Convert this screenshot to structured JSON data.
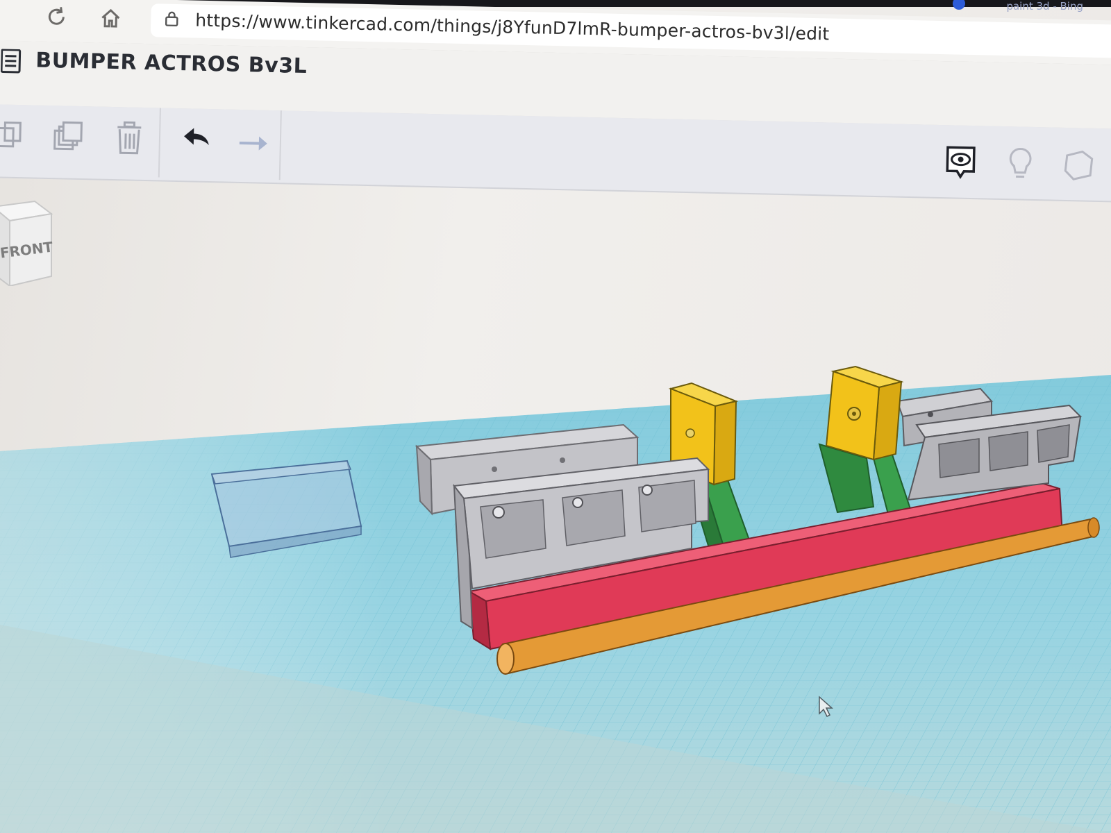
{
  "browser": {
    "url": "https://www.tinkercad.com/things/j8YfunD7lmR-bumper-actros-bv3l/edit",
    "tab_hint": "paint 3d - Bing"
  },
  "app": {
    "title": "BUMPER ACTROS Bv3L"
  },
  "toolbar": {
    "left_tools": [
      "copy-icon",
      "duplicate-icon",
      "trash-icon",
      "undo-icon",
      "redo-icon"
    ],
    "right_tools": [
      "show-all-icon",
      "light-bulb-icon",
      "group-icon"
    ]
  },
  "viewcube": {
    "face_label": "FRONT"
  },
  "scene": {
    "workplane_color": "#8fd3e4",
    "objects": [
      "transparent-box",
      "gray-rail-back",
      "gray-rail-front",
      "gray-rail-right-back",
      "gray-rail-right-front",
      "yellow-bracket-left",
      "yellow-bracket-right",
      "green-strut-left",
      "green-strut-right",
      "red-beam",
      "orange-bar"
    ],
    "colors": {
      "gray": "#bdbdc2",
      "yellow": "#f2c21a",
      "green": "#3aa04d",
      "red": "#e03a57",
      "orange": "#e49a36",
      "glass": "#a9c7e0"
    }
  }
}
